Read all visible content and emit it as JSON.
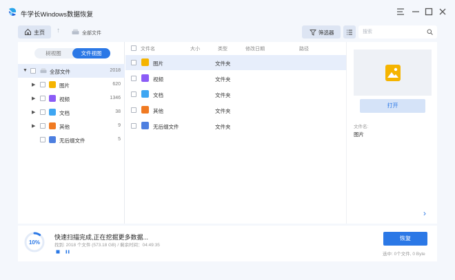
{
  "app": {
    "title": "牛学长Windows数据恢复"
  },
  "toolbar": {
    "home_label": "主页",
    "breadcrumb": "全部文件",
    "filter_label": "筛选器",
    "search_placeholder": "搜索"
  },
  "left_panel": {
    "tab_tree": "树视图",
    "tab_file": "文件视图",
    "active_tab": "文件视图",
    "root": {
      "label": "全部文件",
      "count": "2018"
    },
    "items": [
      {
        "label": "图片",
        "count": "620",
        "icon": "image-icon",
        "color": "#f5b400"
      },
      {
        "label": "视频",
        "count": "1346",
        "icon": "video-icon",
        "color": "#8b5cf6"
      },
      {
        "label": "文档",
        "count": "38",
        "icon": "document-icon",
        "color": "#3ea6f2"
      },
      {
        "label": "其他",
        "count": "9",
        "icon": "other-icon",
        "color": "#f07a22"
      },
      {
        "label": "无后缀文件",
        "count": "5",
        "icon": "unknown-file-icon",
        "color": "#4d7fe0"
      }
    ]
  },
  "file_list": {
    "columns": [
      "文件名",
      "大小",
      "类型",
      "修改日期",
      "路径"
    ],
    "rows": [
      {
        "name": "图片",
        "type": "文件夹",
        "icon": "image-icon",
        "selected": true
      },
      {
        "name": "视频",
        "type": "文件夹",
        "icon": "video-icon"
      },
      {
        "name": "文档",
        "type": "文件夹",
        "icon": "document-icon"
      },
      {
        "name": "其他",
        "type": "文件夹",
        "icon": "other-icon"
      },
      {
        "name": "无后缀文件",
        "type": "文件夹",
        "icon": "unknown-file-icon"
      }
    ]
  },
  "preview": {
    "open_label": "打开",
    "filename_label": "文件名:",
    "filename_value": "图片"
  },
  "scan": {
    "progress": 0.1,
    "progress_text": "10%",
    "status": "快速扫描完成,正在挖掘更多数据...",
    "found": "找到: 2018 个文件 (573.18 GB) / 剩余时间：04:49:35"
  },
  "footer": {
    "recover_label": "恢复",
    "selected_info": "选中: 0个文件, 0 Byte"
  },
  "colors": {
    "accent": "#2b78e6",
    "selected_row": "#e7eefb"
  }
}
